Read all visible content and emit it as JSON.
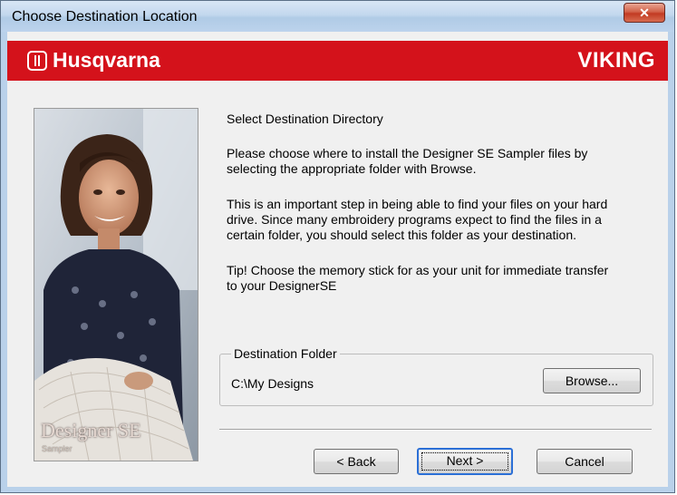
{
  "window": {
    "title": "Choose Destination Location",
    "close_glyph": "✕"
  },
  "banner": {
    "brand_left": "Husqvarna",
    "brand_right": "VIKING",
    "color": "#d4121b"
  },
  "photo": {
    "caption": "Designer SE",
    "subcaption": "Sampler"
  },
  "content": {
    "heading": "Select Destination Directory",
    "para1_line1": "Please choose where to install the Designer SE Sampler files by",
    "para1_line2": "selecting the appropriate folder with Browse.",
    "para2_line1": "This is an important step in being able to find your files on your hard",
    "para2_line2": "drive. Since many embroidery programs expect to find the files in a",
    "para2_line3": "certain folder, you should select this folder as your destination.",
    "para3_line1": "Tip! Choose the memory stick for as your unit for immediate transfer",
    "para3_line2": "to your DesignerSE"
  },
  "destination": {
    "group_label": "Destination Folder",
    "path": "C:\\My Designs",
    "browse_label": "Browse..."
  },
  "buttons": {
    "back": "< Back",
    "next": "Next >",
    "cancel": "Cancel"
  }
}
